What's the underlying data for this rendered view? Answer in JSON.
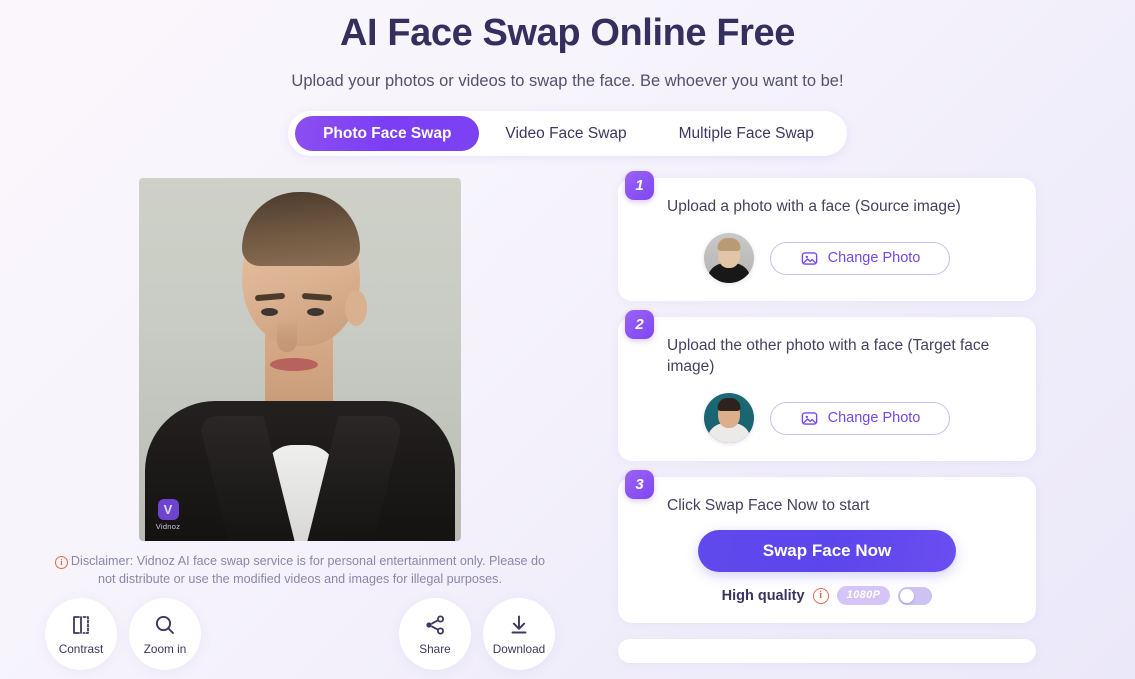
{
  "header": {
    "title": "AI Face Swap Online Free",
    "subtitle": "Upload your photos or videos to swap the face. Be whoever you want to be!"
  },
  "tabs": [
    {
      "label": "Photo Face Swap",
      "active": true
    },
    {
      "label": "Video Face Swap",
      "active": false
    },
    {
      "label": "Multiple Face Swap",
      "active": false
    }
  ],
  "preview": {
    "watermark_logo": "V",
    "watermark_text": "Vidnoz"
  },
  "disclaimer": {
    "icon": "info-circle-icon",
    "text": "Disclaimer: Vidnoz AI face swap service is for personal entertainment only. Please do not distribute or use the modified videos and images for illegal purposes."
  },
  "toolbar": {
    "left": [
      {
        "label": "Contrast",
        "icon": "contrast-icon"
      },
      {
        "label": "Zoom in",
        "icon": "magnifier-icon"
      }
    ],
    "right": [
      {
        "label": "Share",
        "icon": "share-icon"
      },
      {
        "label": "Download",
        "icon": "download-icon"
      }
    ]
  },
  "steps": [
    {
      "number": "1",
      "title": "Upload a photo with a face (Source image)",
      "avatar": "source-face-thumbnail",
      "button_label": "Change Photo",
      "button_icon": "image-icon"
    },
    {
      "number": "2",
      "title": "Upload the other photo with a face (Target face image)",
      "avatar": "target-face-thumbnail",
      "button_label": "Change Photo",
      "button_icon": "image-icon"
    },
    {
      "number": "3",
      "title": "Click Swap Face Now to start",
      "swap_button_label": "Swap Face Now",
      "quality_label": "High quality",
      "quality_info_icon": "info-circle-icon",
      "quality_badge": "1080P",
      "quality_toggle_on": false
    }
  ],
  "colors": {
    "accent_purple": "#7c3ef5",
    "swap_button": "#5b45ec",
    "title_navy": "#352f5e",
    "info_orange": "#e1694a",
    "badge_lavender": "#d5c4f8",
    "page_bg_start": "#fbf6fb",
    "page_bg_end": "#ebe8f9"
  }
}
